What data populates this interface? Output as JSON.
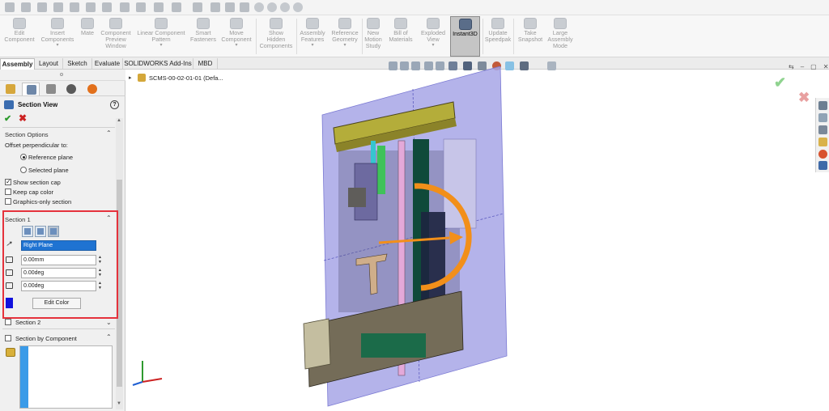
{
  "ribbon": {
    "buttons": [
      {
        "label": "Edit\nComponent"
      },
      {
        "label": "Insert\nComponents"
      },
      {
        "label": "Mate"
      },
      {
        "label": "Component\nPreview\nWindow"
      },
      {
        "label": "Linear Component\nPattern"
      },
      {
        "label": "Smart\nFasteners"
      },
      {
        "label": "Move\nComponent"
      },
      {
        "label": "Show\nHidden\nComponents"
      },
      {
        "label": "Assembly\nFeatures"
      },
      {
        "label": "Reference\nGeometry"
      },
      {
        "label": "New\nMotion\nStudy"
      },
      {
        "label": "Bill of\nMaterials"
      },
      {
        "label": "Exploded\nView"
      },
      {
        "label": "Instant3D"
      },
      {
        "label": "Update\nSpeedpak"
      },
      {
        "label": "Take\nSnapshot"
      },
      {
        "label": "Large\nAssembly\nMode"
      }
    ]
  },
  "tabs": [
    {
      "label": "Assembly"
    },
    {
      "label": "Layout"
    },
    {
      "label": "Sketch"
    },
    {
      "label": "Evaluate"
    },
    {
      "label": "SOLIDWORKS Add-Ins"
    },
    {
      "label": "MBD"
    }
  ],
  "property_manager": {
    "title": "Section View",
    "help": "?",
    "section_options": {
      "title": "Section Options",
      "offset_label": "Offset perpendicular to:",
      "radio_reference": "Reference plane",
      "radio_selected": "Selected plane",
      "show_cap": "Show section cap",
      "keep_cap_color": "Keep cap color",
      "graphics_only": "Graphics-only section"
    },
    "section1": {
      "title": "Section 1",
      "plane": "Right Plane",
      "offset": "0.00mm",
      "angle_x": "0.00deg",
      "angle_y": "0.00deg",
      "edit_color": "Edit Color",
      "color": "#1111dd"
    },
    "section2": {
      "title": "Section 2"
    },
    "section_by_component": {
      "title": "Section by Component"
    }
  },
  "tree": {
    "label": "SCMS-00-02-01-01 (Defa..."
  },
  "colors": {
    "highlight_box": "#e5323c",
    "selection_blue": "#1f73d2",
    "section_plane": "#a7a6e6"
  }
}
